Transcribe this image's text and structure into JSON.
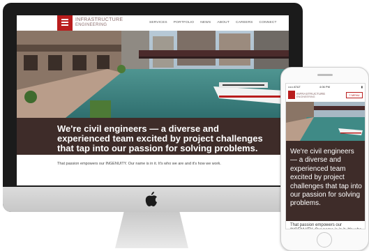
{
  "site": {
    "logo_line1": "INFRASTRUCTURE",
    "logo_line2": "ENGINEERING",
    "nav": [
      "SERVICES",
      "PORTFOLIO",
      "NEWS",
      "ABOUT",
      "CAREERS",
      "CONNECT"
    ],
    "headline": "We're civil engineers — a diverse and experienced team excited by project challenges that tap into our passion for solving problems.",
    "tagline": "That passion empowers our INGENUITY. Our name is in it. It's who we are and it's how we work."
  },
  "mobile": {
    "carrier": "••••• AT&T",
    "time": "4:06 PM",
    "battery": "▮",
    "menu_label": "MENU",
    "headline": "We're civil engineers — a diverse and experienced team excited by project challenges that tap into our passion for solving problems.",
    "tagline": "That passion empowers our INGENUITY. Our name is in it. It's who we are and it's how we work."
  },
  "colors": {
    "brand_red": "#b91d1d",
    "band_brown": "#3e2c29",
    "river": "#3f8a86"
  },
  "icons": {
    "apple": "apple-icon",
    "menu": "hamburger-icon",
    "home": "home-button-icon"
  }
}
